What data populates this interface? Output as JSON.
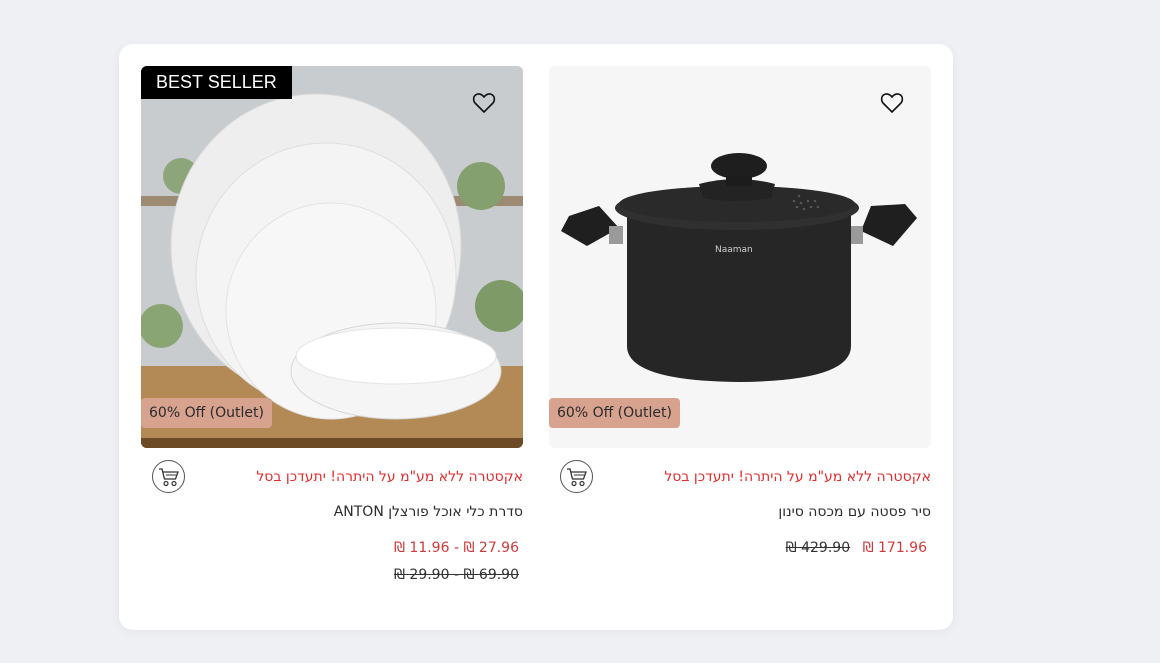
{
  "products": [
    {
      "best_seller": "BEST SELLER",
      "discount_badge": "60% Off (Outlet)",
      "promo": "אקסטרה ללא מע\"מ על היתרה! יתעדכן בסל",
      "title": "סדרת כלי אוכל פורצלן ANTON",
      "sale_price": "27.96 ₪ - 11.96 ₪",
      "old_price": "69.90 ₪ - 29.90 ₪",
      "wishlist_icon": "heart-outline-icon",
      "cart_icon": "shopping-cart-icon"
    },
    {
      "discount_badge": "60% Off (Outlet)",
      "promo": "אקסטרה ללא מע\"מ על היתרה! יתעדכן בסל",
      "title": "סיר פסטה עם מכסה סינון",
      "sale_price": "171.96 ₪",
      "old_price": "429.90 ₪",
      "brand_mark": "Naaman",
      "wishlist_icon": "heart-outline-icon",
      "cart_icon": "shopping-cart-icon"
    }
  ],
  "colors": {
    "page_bg": "#eef0f4",
    "promo_red": "#e52b2b",
    "sale_red": "#d13a3a",
    "badge_bg": "#d7a28e"
  }
}
